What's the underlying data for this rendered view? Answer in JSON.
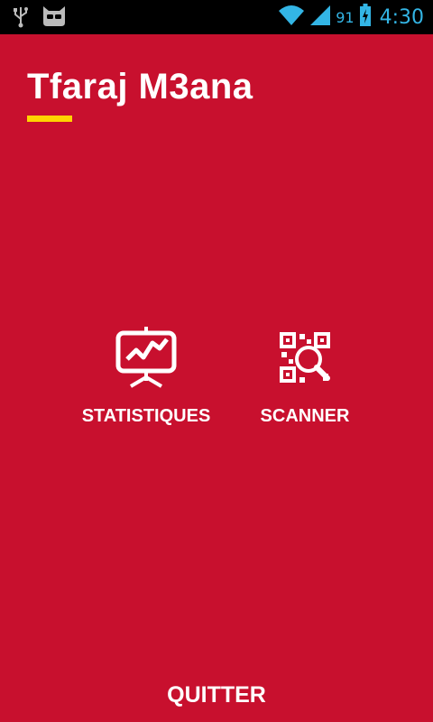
{
  "status_bar": {
    "battery_percent": "91",
    "time": "4:30",
    "icons": [
      "usb-icon",
      "cyanogen-mascot-icon",
      "wifi-icon",
      "signal-icon",
      "battery-charging-icon"
    ]
  },
  "app": {
    "title": "Tfaraj M3ana",
    "accent_color": "#ffd400",
    "background_color": "#c8102e"
  },
  "menu": {
    "items": [
      {
        "label": "STATISTIQUES",
        "icon": "presentation-chart-icon"
      },
      {
        "label": "SCANNER",
        "icon": "qr-scan-icon"
      }
    ]
  },
  "footer": {
    "quit_label": "QUITTER"
  }
}
